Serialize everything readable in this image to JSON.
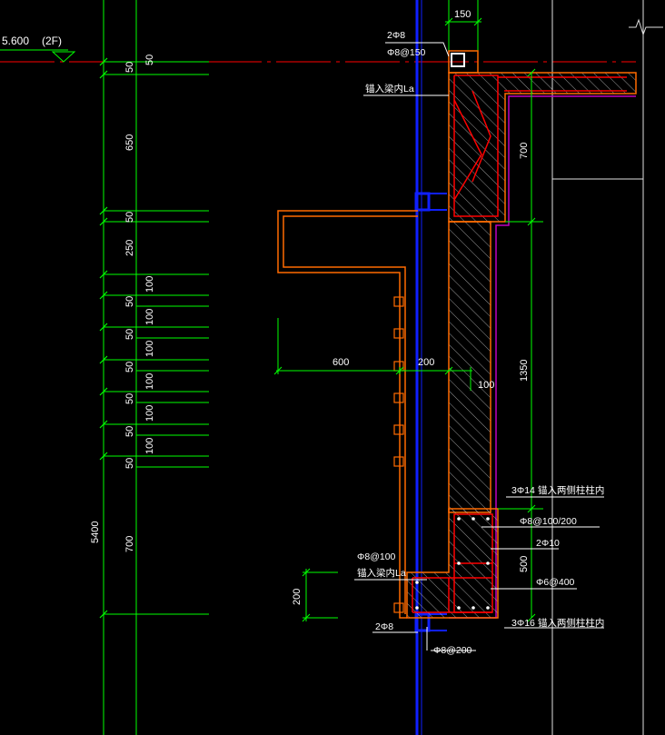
{
  "colors": {
    "background": "#000000",
    "dimension_line": "#00ff00",
    "concrete_outline": "#ff6a00",
    "window_frame": "#0000ff",
    "rebar": "#ff0000",
    "hatch": "#cccccc",
    "insulation": "#c000c0",
    "axis": "#ff0000",
    "text": "#ffffff"
  },
  "level": {
    "elevation": "5.600",
    "floor": "(2F)"
  },
  "dimensions": {
    "top_width": "150",
    "chain_outer": [
      "50",
      "650",
      "50",
      "250",
      "50",
      "50",
      "50",
      "50",
      "50",
      "50",
      "700"
    ],
    "chain_inner": [
      "50",
      "100",
      "100",
      "100",
      "100",
      "100",
      "100"
    ],
    "total_height": "5400",
    "canopy_projection": "600",
    "wall_thickness": "200",
    "insulation": "100",
    "beam_height_upper": "700",
    "wall_height": "1350",
    "beam_height_lower": "500",
    "sill_height": "200"
  },
  "annotations": {
    "top_rebar": "2Φ8",
    "top_stirrup": "Φ8@150",
    "anchor_upper": "锚入梁内La",
    "lower_longitudinal_top": "3Φ14  锚入两侧柱柱内",
    "lower_stirrup": "Φ8@100/200",
    "lower_waist_bar": "2Φ10",
    "lower_tie": "Φ6@400",
    "lower_longitudinal_bottom": "3Φ16  锚入两侧柱柱内",
    "sill_stirrup": "Φ8@100",
    "anchor_lower": "锚入梁内La",
    "sill_rebar": "2Φ8",
    "bottom_stirrup": "Φ8@200"
  }
}
